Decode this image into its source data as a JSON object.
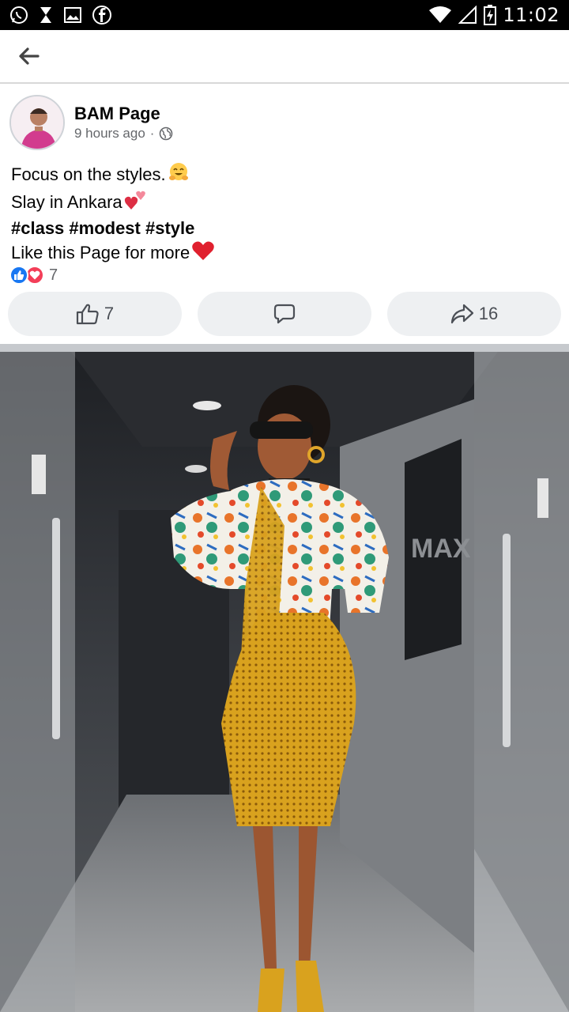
{
  "status_bar": {
    "time": "11:02",
    "left_icons": [
      "whatsapp-icon",
      "hourglass-icon",
      "gallery-icon",
      "facebook-icon"
    ],
    "right_icons": [
      "wifi-icon",
      "signal-icon",
      "battery-charging-icon"
    ]
  },
  "app_bar": {
    "back_icon": "back-arrow-icon"
  },
  "post": {
    "page_name": "BAM Page",
    "time_ago": "9 hours ago",
    "separator": "·",
    "privacy_icon": "globe-icon",
    "lines": [
      "Focus on the styles.",
      "Slay in Ankara",
      "#class #modest #style",
      "Like this Page for more"
    ],
    "reactions": {
      "types": [
        "like-reaction-icon",
        "love-reaction-icon"
      ],
      "count": "7"
    },
    "actions": {
      "like_count": "7",
      "share_count": "16"
    }
  },
  "colors": {
    "facebook_blue": "#1877f2",
    "love_red": "#f33e58",
    "button_bg": "#eef0f2",
    "meta_gray": "#65676b"
  }
}
